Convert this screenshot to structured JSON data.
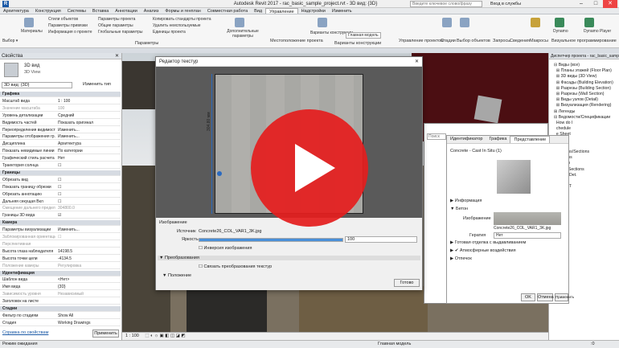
{
  "window": {
    "title": "Autodesk Revit 2017 -   rac_basic_sample_project.rvt - 3D вид: {3D}",
    "search_placeholder": "Введите ключевое слово/фразу",
    "signin": "Вход в службы",
    "min": "–",
    "max": "□",
    "close": "✕"
  },
  "ribbon_tabs": [
    "Архитектура",
    "Конструкция",
    "Системы",
    "Вставка",
    "Аннотации",
    "Анализ",
    "Формы и генплан",
    "Совместная работа",
    "Вид",
    "Управление",
    "Надстройки",
    "Изменить"
  ],
  "active_tab": "Управление",
  "ribbon": {
    "select": "Выбор ▾",
    "materials": "Материалы",
    "items_col1": [
      "Стили объектов",
      "Параметры привязки",
      "Информация о проекте"
    ],
    "items_col2": [
      "Параметры проекта",
      "Общие параметры",
      "Глобальные параметры"
    ],
    "items_col3": [
      "Копировать стандарты проекта",
      "Удалить неиспользуемые",
      "Единицы проекта"
    ],
    "items_col4": [
      "Дополнительные параметры"
    ],
    "group_params": "Параметры",
    "group_location": "Местоположение проекта",
    "group_variants": "Варианты конструкции",
    "main_model": "Главная модель",
    "variants_btn": "Варианты конструкции",
    "group_manage": "Управление проектом",
    "group_stages": "Стадии",
    "group_select": "Выбор",
    "group_query": "Запросы",
    "group_info": "Сведения",
    "group_macros": "Макросы",
    "group_visual": "Визуальное программирование",
    "dynamo": "Dynamo",
    "player": "Dynamo Player",
    "phases": "Стадии",
    "select_objects": "Выбор объектов"
  },
  "properties": {
    "title": "Свойства",
    "close": "✕",
    "type_name": "3D вид",
    "type_sub": "3D View",
    "instance_select": "3D вид: {3D}",
    "edit_type": "Изменить тип",
    "rows": [
      {
        "k": "Графика",
        "v": "",
        "sec": true
      },
      {
        "k": "Масштаб вида",
        "v": "1 : 100"
      },
      {
        "k": "Значение масштаба",
        "v": "100",
        "gray": true
      },
      {
        "k": "Уровень детализации",
        "v": "Средний"
      },
      {
        "k": "Видимость частей",
        "v": "Показать оригинал"
      },
      {
        "k": "Переопределения видимости...",
        "v": "Изменить..."
      },
      {
        "k": "Параметры отображения гр...",
        "v": "Изменить..."
      },
      {
        "k": "Дисциплина",
        "v": "Архитектура"
      },
      {
        "k": "Показать невидимые линии",
        "v": "По категории"
      },
      {
        "k": "Графический стиль расчета ...",
        "v": "Нет"
      },
      {
        "k": "Траектория солнца",
        "v": "☐"
      },
      {
        "k": "Границы",
        "v": "",
        "sec": true
      },
      {
        "k": "Обрезать вид",
        "v": "☐"
      },
      {
        "k": "Показать границу обрезки",
        "v": "☐"
      },
      {
        "k": "Обрезать аннотацию",
        "v": "☐"
      },
      {
        "k": "Дальняя секущая Вкл",
        "v": "☐"
      },
      {
        "k": "Смещение дальнего предел...",
        "v": "304800.0",
        "gray": true
      },
      {
        "k": "Границы 3D вида",
        "v": "☑"
      },
      {
        "k": "Камера",
        "v": "",
        "sec": true
      },
      {
        "k": "Параметры визуализации",
        "v": "Изменить..."
      },
      {
        "k": "Заблокированная ориентация",
        "v": "☐",
        "gray": true
      },
      {
        "k": "Перспективная",
        "v": "",
        "gray": true
      },
      {
        "k": "Высота глаза наблюдателя",
        "v": "14198.5"
      },
      {
        "k": "Высота точки цели",
        "v": "-4134.5"
      },
      {
        "k": "Положение камеры",
        "v": "Регулировка",
        "gray": true
      },
      {
        "k": "Идентификация",
        "v": "",
        "sec": true
      },
      {
        "k": "Шаблон вида",
        "v": "<Нет>"
      },
      {
        "k": "Имя вида",
        "v": "{3D}"
      },
      {
        "k": "Зависимость уровня",
        "v": "Независимый",
        "gray": true
      },
      {
        "k": "Заголовок на листе",
        "v": ""
      },
      {
        "k": "Стадии",
        "v": "",
        "sec": true
      },
      {
        "k": "Фильтр по стадиям",
        "v": "Show All"
      },
      {
        "k": "Стадия",
        "v": "Working Drawings"
      }
    ],
    "help_link": "Справка по свойствам",
    "apply": "Применить"
  },
  "viewbar": {
    "scale": "1 : 100",
    "icons": "⬚ ◐ ☼ ▣ ◧ ◫ ◪ ◩"
  },
  "browser": {
    "title": "Диспетчер проекта - rac_basic_sample_project",
    "items": [
      "⊟ Виды (все)",
      "  ⊞ Планы этажей (Floor Plan)",
      "  ⊞ 3D виды (3D View)",
      "  ⊞ Фасады (Building Elevation)",
      "  ⊞ Разрезы (Building Section)",
      "  ⊞ Разрезы (Wall Section)",
      "  ⊞ Виды узлов (Detail)",
      "  ⊞ Визуализация (Rendering)",
      "⊞ Легенды",
      "⊟ Ведомости/Спецификации",
      "  How do I",
      "  chedule",
      "  e Sheet",
      "  e Plan",
      "  Details",
      "  Sections/Sections",
      "  Sections",
      "  Section",
      "  / Stair Sections",
      "  o Sec./Det.",
      "  Views",
      "  ere RVT"
    ]
  },
  "texture_editor": {
    "title": "Редактор текстур",
    "close": "✕",
    "dimension": "304.80 мм",
    "panel_header": "Изображение",
    "source_label": "Источник",
    "source_value": "Concrete26_COL_VAR1_3K.jpg",
    "brightness_label": "Яркость",
    "brightness_value": "100",
    "brightness": 1.0,
    "invert": "Инверсия изображения",
    "transforms": "▼ Преобразования",
    "link_transforms": "Связать преобразования текстур",
    "position": "▼ Положение",
    "done": "Готово"
  },
  "material_browser": {
    "search": "Поиск",
    "tabs": [
      "Идентификатор",
      "Графика",
      "Представление"
    ],
    "active_tab": "Представление",
    "asset_name": "Concrete - Cast In Situ (1)",
    "info": "▶ Информация",
    "concrete": "▼ Бетон",
    "image_label": "Изображение",
    "image_file": "Concrete26_COL_VAR1_3K.jpg",
    "tint_label": "Гератия",
    "tint_value": "Нет",
    "finish": "▶ Готовая отделка с выдавливанием",
    "weathering": "▶ ✔ Атмосферные воздействия",
    "relief": "▶ Отпечок",
    "ok": "OK",
    "cancel": "Отмена",
    "apply": "Применить"
  },
  "status": {
    "text": "Режим ожидания",
    "model": "Главная модель",
    "zoom": ":0"
  },
  "colors": {
    "play": "#e41e1e",
    "accent": "#1c5aa6"
  }
}
